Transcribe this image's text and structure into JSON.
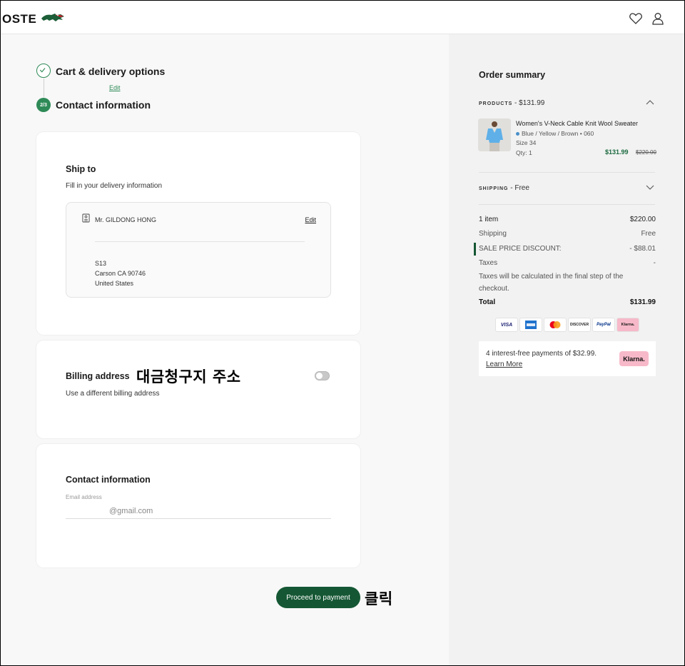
{
  "header": {
    "logo_text": "OSTE",
    "wishlist_icon": "heart-icon",
    "account_icon": "user-icon"
  },
  "steps": [
    {
      "title": "Cart & delivery options",
      "edit_label": "Edit",
      "state": "done"
    },
    {
      "title": "Contact information",
      "badge": "2/3",
      "state": "current"
    }
  ],
  "ship_to": {
    "title": "Ship to",
    "subtitle": "Fill in your delivery information",
    "name": "Mr. GILDONG HONG",
    "edit_label": "Edit",
    "address_lines": [
      "S13",
      "Carson CA 90746",
      "United States"
    ]
  },
  "billing": {
    "title": "Billing address",
    "subtitle": "Use a different billing address",
    "toggle_on": false,
    "annotation": "대금청구지 주소"
  },
  "contact": {
    "title": "Contact information",
    "email_label": "Email address",
    "email_value": "@gmail.com"
  },
  "proceed": {
    "label": "Proceed to payment",
    "annotation": "클릭",
    "color": "#155734"
  },
  "summary": {
    "title": "Order summary",
    "products_label": "PRODUCTS",
    "products_total": " - $131.99",
    "product": {
      "name": "Women's V-Neck Cable Knit Wool Sweater",
      "color": "Blue / Yellow / Brown • 060",
      "size": "Size 34",
      "qty": "Qty: 1",
      "price": "$131.99",
      "original_price": "$220.00"
    },
    "shipping_label": "SHIPPING",
    "shipping_value": " - Free",
    "rows": [
      {
        "label": "1 item",
        "value": "$220.00"
      },
      {
        "label": "Shipping",
        "value": "Free"
      },
      {
        "label": "SALE PRICE DISCOUNT:",
        "value": "- $88.01"
      },
      {
        "label": "Taxes",
        "value": "-"
      }
    ],
    "taxes_note": "Taxes will be calculated in the final step of the checkout.",
    "total_label": "Total",
    "total_value": "$131.99",
    "payment_methods": [
      "VISA",
      "AMEX",
      "MC",
      "DISCOVER",
      "PayPal",
      "Klarna."
    ],
    "klarna": {
      "text": "4 interest-free payments of $32.99.",
      "learn_more": "Learn More",
      "badge": "Klarna."
    }
  },
  "colors": {
    "brand_green": "#2e8a57",
    "dark_green": "#155734",
    "price_green": "#1b6a3f"
  }
}
